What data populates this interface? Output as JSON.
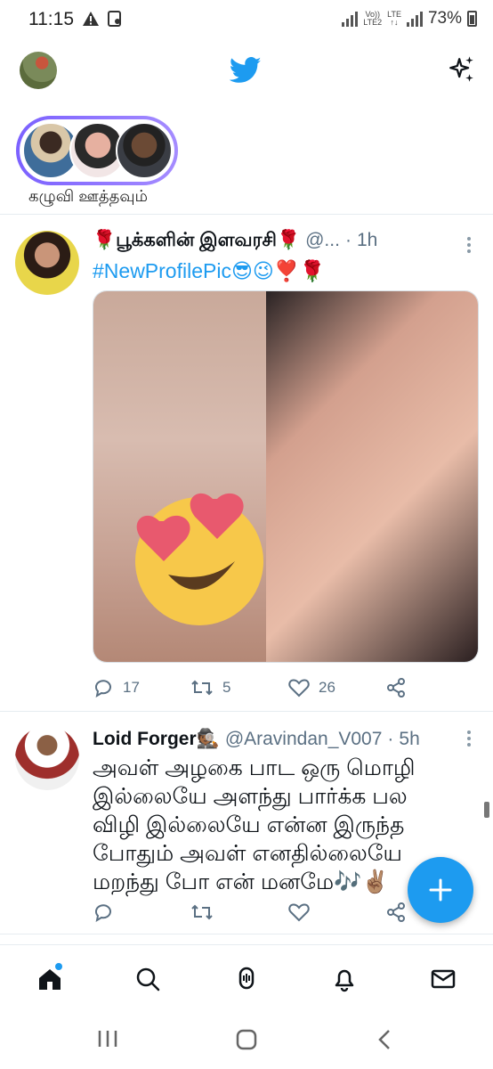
{
  "status_bar": {
    "time": "11:15",
    "battery": "73%",
    "network_label_top": "Vo))",
    "network_label_bottom": "LTE2",
    "lte_label": "LTE"
  },
  "colors": {
    "accent": "#1d9bf0",
    "fleet_ring": "#7b61ff",
    "secondary_text": "#5b7083"
  },
  "fleets": {
    "label": "கழுவி ஊத்தவும்"
  },
  "tweets": [
    {
      "name": "🌹பூக்களின் இளவரசி🌹",
      "handle": "@...",
      "dot": "·",
      "time": "1h",
      "text": "#NewProfilePic😎😉❣️🌹",
      "replies": "17",
      "retweets": "5",
      "likes": "26"
    },
    {
      "name": "Loid Forger🕵🏾",
      "handle": "@Aravindan_V007",
      "dot": "·",
      "time": "5h",
      "text": "அவள் அழகை பாட ஒரு மொழி\nஇல்லையே அளந்து பார்க்க பல\nவிழி இல்லையே என்ன இருந்த\nபோதும் அவள் எனதில்லையே\nமறந்து போ என் மனமே🎶✌🏽"
    }
  ],
  "icons": {
    "compose": "plus-icon",
    "home": "home-icon",
    "search": "search-icon",
    "spaces": "spaces-icon",
    "notifications": "bell-icon",
    "messages": "mail-icon"
  }
}
